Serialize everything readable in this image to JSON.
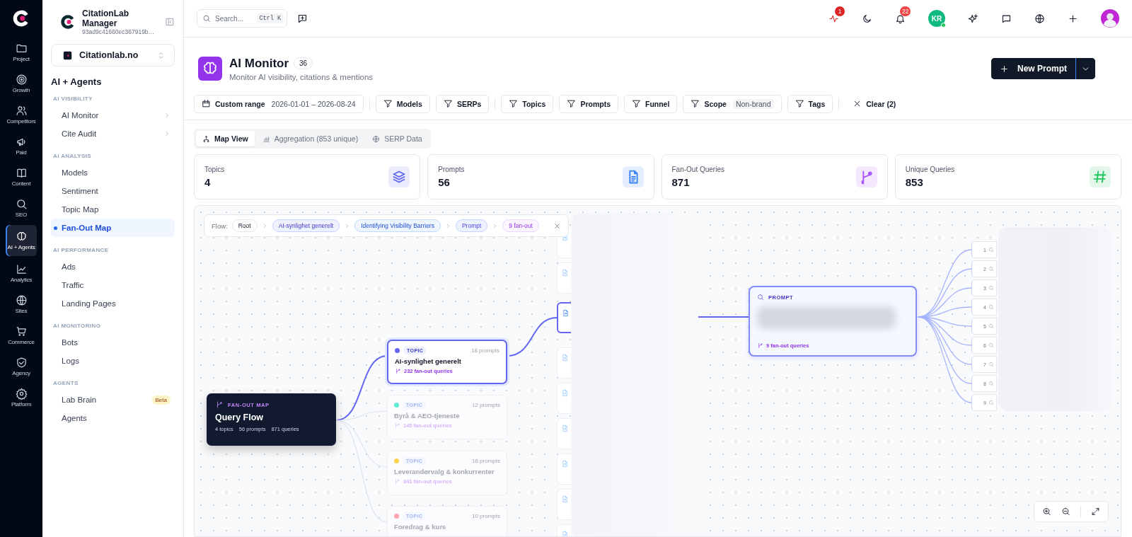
{
  "rail": {
    "items": [
      {
        "label": "Project",
        "selected": false
      },
      {
        "label": "Growth",
        "selected": false
      },
      {
        "label": "Competitors",
        "selected": false
      },
      {
        "label": "Paid",
        "selected": false
      },
      {
        "label": "Content",
        "selected": false
      },
      {
        "label": "SEO",
        "selected": false
      },
      {
        "label": "AI + Agents",
        "selected": true
      },
      {
        "label": "Analytics",
        "selected": false
      },
      {
        "label": "Sites",
        "selected": false
      },
      {
        "label": "Commerce",
        "selected": false
      },
      {
        "label": "Agency",
        "selected": false
      },
      {
        "label": "Platform",
        "selected": false
      }
    ]
  },
  "sidebar": {
    "account": {
      "name": "CitationLab Manager",
      "id": "93ad9c41660ec367919b…"
    },
    "project": "Citationlab.no",
    "title": "AI + Agents",
    "groups": [
      {
        "title": "AI VISIBILITY",
        "items": [
          {
            "label": "AI Monitor",
            "selected": false,
            "submenu": true
          },
          {
            "label": "Cite Audit",
            "selected": false,
            "submenu": true
          }
        ]
      },
      {
        "title": "AI ANALYSIS",
        "items": [
          {
            "label": "Models",
            "selected": false
          },
          {
            "label": "Sentiment",
            "selected": false
          },
          {
            "label": "Topic Map",
            "selected": false
          },
          {
            "label": "Fan-Out Map",
            "selected": true
          }
        ]
      },
      {
        "title": "AI PERFORMANCE",
        "items": [
          {
            "label": "Ads",
            "selected": false
          },
          {
            "label": "Traffic",
            "selected": false
          },
          {
            "label": "Landing Pages",
            "selected": false
          }
        ]
      },
      {
        "title": "AI MONITORING",
        "items": [
          {
            "label": "Bots",
            "selected": false
          },
          {
            "label": "Logs",
            "selected": false
          }
        ]
      },
      {
        "title": "AGENTS",
        "items": [
          {
            "label": "Lab Brain",
            "selected": false,
            "badge": "Beta"
          },
          {
            "label": "Agents",
            "selected": false
          }
        ]
      }
    ]
  },
  "topbar": {
    "search": {
      "placeholder": "Search...",
      "shortcut": "Ctrl K"
    },
    "activity_badge": "1",
    "notifications_badge": "22",
    "initials": "KR",
    "online": true
  },
  "header": {
    "title": "AI Monitor",
    "count": "36",
    "subtitle": "Monitor AI visibility, citations & mentions",
    "primary_button": "New Prompt"
  },
  "filter_groups": [
    [
      {
        "kind": "date",
        "label": "Custom range",
        "value": "2026-01-01 – 2026-08-24"
      }
    ],
    [
      {
        "kind": "filter",
        "label": "Models"
      },
      {
        "kind": "filter",
        "label": "SERPs"
      }
    ],
    [
      {
        "kind": "filter",
        "label": "Topics"
      },
      {
        "kind": "filter",
        "label": "Prompts"
      },
      {
        "kind": "filter",
        "label": "Funnel"
      },
      {
        "kind": "filter",
        "label": "Scope",
        "value": "Non-brand"
      },
      {
        "kind": "filter",
        "label": "Tags"
      }
    ],
    [
      {
        "kind": "clear",
        "label": "Clear (2)"
      }
    ]
  ],
  "tabs": [
    {
      "label": "Map View",
      "selected": true
    },
    {
      "label": "Aggregation (853 unique)",
      "selected": false
    },
    {
      "label": "SERP Data",
      "selected": false
    }
  ],
  "stats": [
    {
      "label": "Topics",
      "value": "4",
      "color": "#6366f1"
    },
    {
      "label": "Prompts",
      "value": "56",
      "color": "#3b82f6"
    },
    {
      "label": "Fan-Out Queries",
      "value": "871",
      "color": "#a855f7"
    },
    {
      "label": "Unique Queries",
      "value": "853",
      "color": "#22c55e"
    }
  ],
  "flow": {
    "label": "Flow:",
    "steps": [
      {
        "kind": "root",
        "label": "Root"
      },
      {
        "kind": "topic",
        "label": "AI-synlighet generelt"
      },
      {
        "kind": "document",
        "label": "Identifying Visibility Barriers"
      },
      {
        "kind": "prompt",
        "label": "Prompt"
      },
      {
        "kind": "fanout",
        "label": "9 fan-out"
      }
    ]
  },
  "root_node": {
    "label": "FAN-OUT MAP",
    "title": "Query Flow",
    "stats": [
      "4 topics",
      "56 prompts",
      "871 queries"
    ]
  },
  "topics": [
    {
      "label": "TOPIC",
      "title": "AI-synlighet generelt",
      "prompts": "18 prompts",
      "queries": "232 fan-out queries",
      "color": "#6366f1",
      "selected": true
    },
    {
      "label": "TOPIC",
      "title": "Byrå & AEO-tjeneste",
      "prompts": "12 prompts",
      "queries": "145 fan-out queries",
      "color": "#5eead4",
      "selected": false
    },
    {
      "label": "TOPIC",
      "title": "Leverandørvalg & konkurrenter",
      "prompts": "16 prompts",
      "queries": "341 fan-out queries",
      "color": "#fcd34d",
      "selected": false
    },
    {
      "label": "TOPIC",
      "title": "Foredrag & kurs",
      "prompts": "10 prompts",
      "color": "#fda4af",
      "selected": false
    }
  ],
  "documents": [
    {
      "selected": false
    },
    {
      "selected": false
    },
    {
      "selected": true
    },
    {
      "selected": false
    },
    {
      "selected": false
    },
    {
      "selected": false
    },
    {
      "selected": false
    },
    {
      "selected": false
    },
    {
      "selected": false
    }
  ],
  "prompt_node": {
    "label": "PROMPT",
    "queries": "9 fan-out queries"
  },
  "fanout": [
    "1",
    "2",
    "3",
    "4",
    "5",
    "6",
    "7",
    "8",
    "9"
  ]
}
